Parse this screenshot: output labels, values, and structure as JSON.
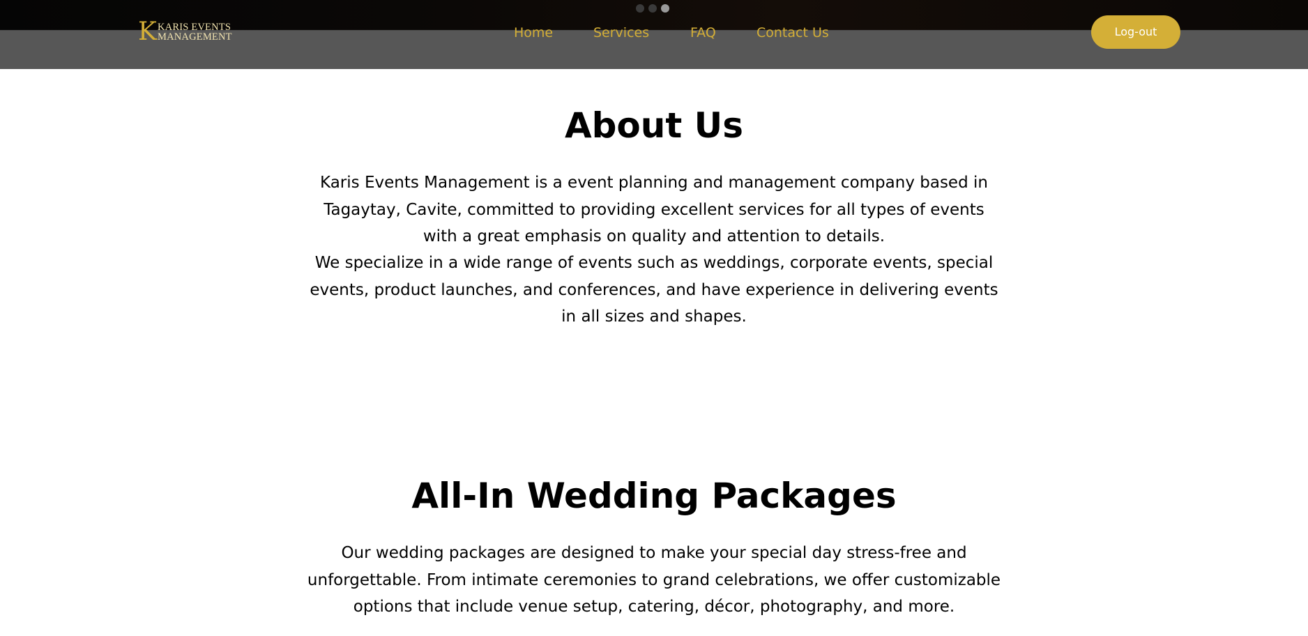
{
  "carousel": {
    "count": 3,
    "active_index": 2
  },
  "header": {
    "logo": {
      "mark": "K",
      "line1": "KARIS EVENTS",
      "line2": "MANAGEMENT"
    },
    "nav": [
      {
        "label": "Home"
      },
      {
        "label": "Services"
      },
      {
        "label": "FAQ"
      },
      {
        "label": "Contact Us"
      }
    ],
    "logout_label": "Log-out"
  },
  "about": {
    "title": "About Us",
    "paragraph1": "Karis Events Management is a event planning and management company based in Tagaytay, Cavite, committed to providing excellent services for all types of events with a great emphasis on quality and attention to details.",
    "paragraph2": "We specialize in a wide range of events such as weddings, corporate events, special events, product launches, and conferences, and have experience in delivering events in all sizes and shapes."
  },
  "packages": {
    "title": "All-In Wedding Packages",
    "paragraph1": "Our wedding packages are designed to make your special day stress-free and unforgettable. From intimate ceremonies to grand celebrations, we offer customizable options that include venue setup, catering, décor, photography, and more."
  },
  "colors": {
    "accent_gold": "#d4af37",
    "navbar_bg": "#505050",
    "hero_bg": "#0b0806",
    "page_bg": "#ffffff",
    "text": "#000000"
  }
}
